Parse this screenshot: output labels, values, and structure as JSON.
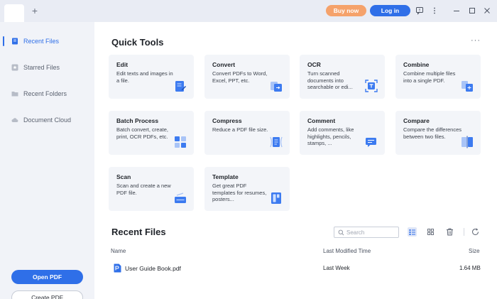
{
  "topbar": {
    "buy_label": "Buy now",
    "login_label": "Log in"
  },
  "sidebar": {
    "items": [
      {
        "label": "Recent Files",
        "icon": "recent-icon",
        "active": true
      },
      {
        "label": "Starred Files",
        "icon": "star-icon",
        "active": false
      },
      {
        "label": "Recent Folders",
        "icon": "folder-icon",
        "active": false
      },
      {
        "label": "Document Cloud",
        "icon": "cloud-icon",
        "active": false
      }
    ],
    "open_label": "Open PDF",
    "create_label": "Create PDF"
  },
  "quick_tools": {
    "title": "Quick Tools",
    "more": "···",
    "tools": [
      {
        "title": "Edit",
        "desc": "Edit texts and images in a file.",
        "icon": "edit-icon"
      },
      {
        "title": "Convert",
        "desc": "Convert PDFs to Word, Excel, PPT, etc.",
        "icon": "convert-icon"
      },
      {
        "title": "OCR",
        "desc": "Turn scanned documents into searchable or edi...",
        "icon": "ocr-icon"
      },
      {
        "title": "Combine",
        "desc": "Combine multiple files into a single PDF.",
        "icon": "combine-icon"
      },
      {
        "title": "Batch Process",
        "desc": "Batch convert, create, print, OCR PDFs, etc.",
        "icon": "batch-icon"
      },
      {
        "title": "Compress",
        "desc": "Reduce a PDF file size.",
        "icon": "compress-icon"
      },
      {
        "title": "Comment",
        "desc": "Add comments, like highlights, pencils, stamps, ...",
        "icon": "comment-icon"
      },
      {
        "title": "Compare",
        "desc": "Compare the differences between two files.",
        "icon": "compare-icon"
      },
      {
        "title": "Scan",
        "desc": "Scan and create a new PDF file.",
        "icon": "scan-icon"
      },
      {
        "title": "Template",
        "desc": "Get great PDF templates for resumes, posters...",
        "icon": "template-icon"
      }
    ]
  },
  "recent": {
    "title": "Recent Files",
    "search_placeholder": "Search",
    "columns": {
      "name": "Name",
      "modified": "Last Modified Time",
      "size": "Size"
    },
    "files": [
      {
        "name": "User Guide Book.pdf",
        "modified": "Last Week",
        "size": "1.64 MB"
      }
    ]
  },
  "colors": {
    "accent": "#2f6fe8",
    "buy": "#f5a26b",
    "sidebar_bg": "#f1f3f8",
    "card_bg": "#f3f5f9"
  }
}
